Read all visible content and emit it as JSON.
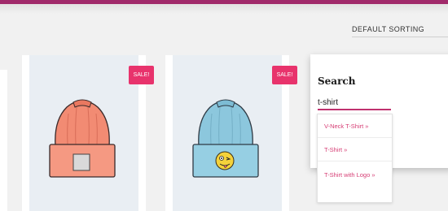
{
  "colors": {
    "accent_bar": "#a12a6b",
    "sale_badge": "#e8336c",
    "suggestion_link": "#d63d74",
    "input_underline": "#c0306e",
    "product_bg": "#e9eef3",
    "hat_salmon": "#f28b73",
    "hat_blue": "#8cc7dd"
  },
  "toolbar": {
    "sorting_label": "DEFAULT SORTING"
  },
  "products": [
    {
      "badge": "SALE!",
      "image": "salmon-beanie-with-patch"
    },
    {
      "badge": "SALE!",
      "image": "blue-beanie-with-emoji"
    }
  ],
  "search": {
    "title": "Search",
    "value": "t-shirt",
    "suggestions": [
      {
        "label": "V-Neck T-Shirt »"
      },
      {
        "label": "T-Shirt »"
      },
      {
        "label": "T-Shirt with Logo »"
      }
    ]
  }
}
